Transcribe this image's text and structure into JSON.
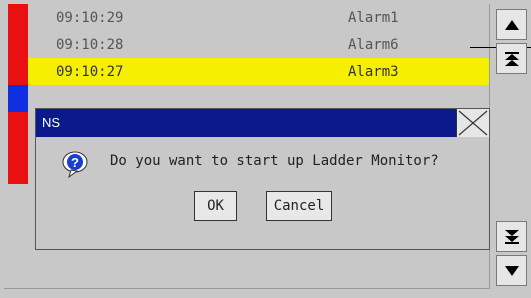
{
  "alarm_list": {
    "rows": [
      {
        "time": "09:10:29",
        "name": "Alarm1",
        "marker_color": "#e81010"
      },
      {
        "time": "09:10:28",
        "name": "Alarm6",
        "marker_color": "#e81010"
      },
      {
        "time": "09:10:27",
        "name": "Alarm3",
        "marker_color": "#e81010",
        "highlight_color": "#f5f000"
      },
      {
        "time": "",
        "name": "",
        "marker_color": "#1030e0"
      },
      {
        "time": "",
        "name": "",
        "marker_color": "#e81010"
      },
      {
        "time": "",
        "name": "",
        "marker_color": "#e81010"
      }
    ]
  },
  "scroll_buttons": {
    "up": "scroll-up-icon",
    "page_up": "page-up-icon",
    "page_down": "page-down-icon",
    "down": "scroll-down-icon"
  },
  "dialog": {
    "title": "NS",
    "message": "Do you want to start up Ladder Monitor?",
    "ok_label": "OK",
    "cancel_label": "Cancel",
    "icon": "question-icon",
    "title_bar_color": "#0a1a8c"
  }
}
